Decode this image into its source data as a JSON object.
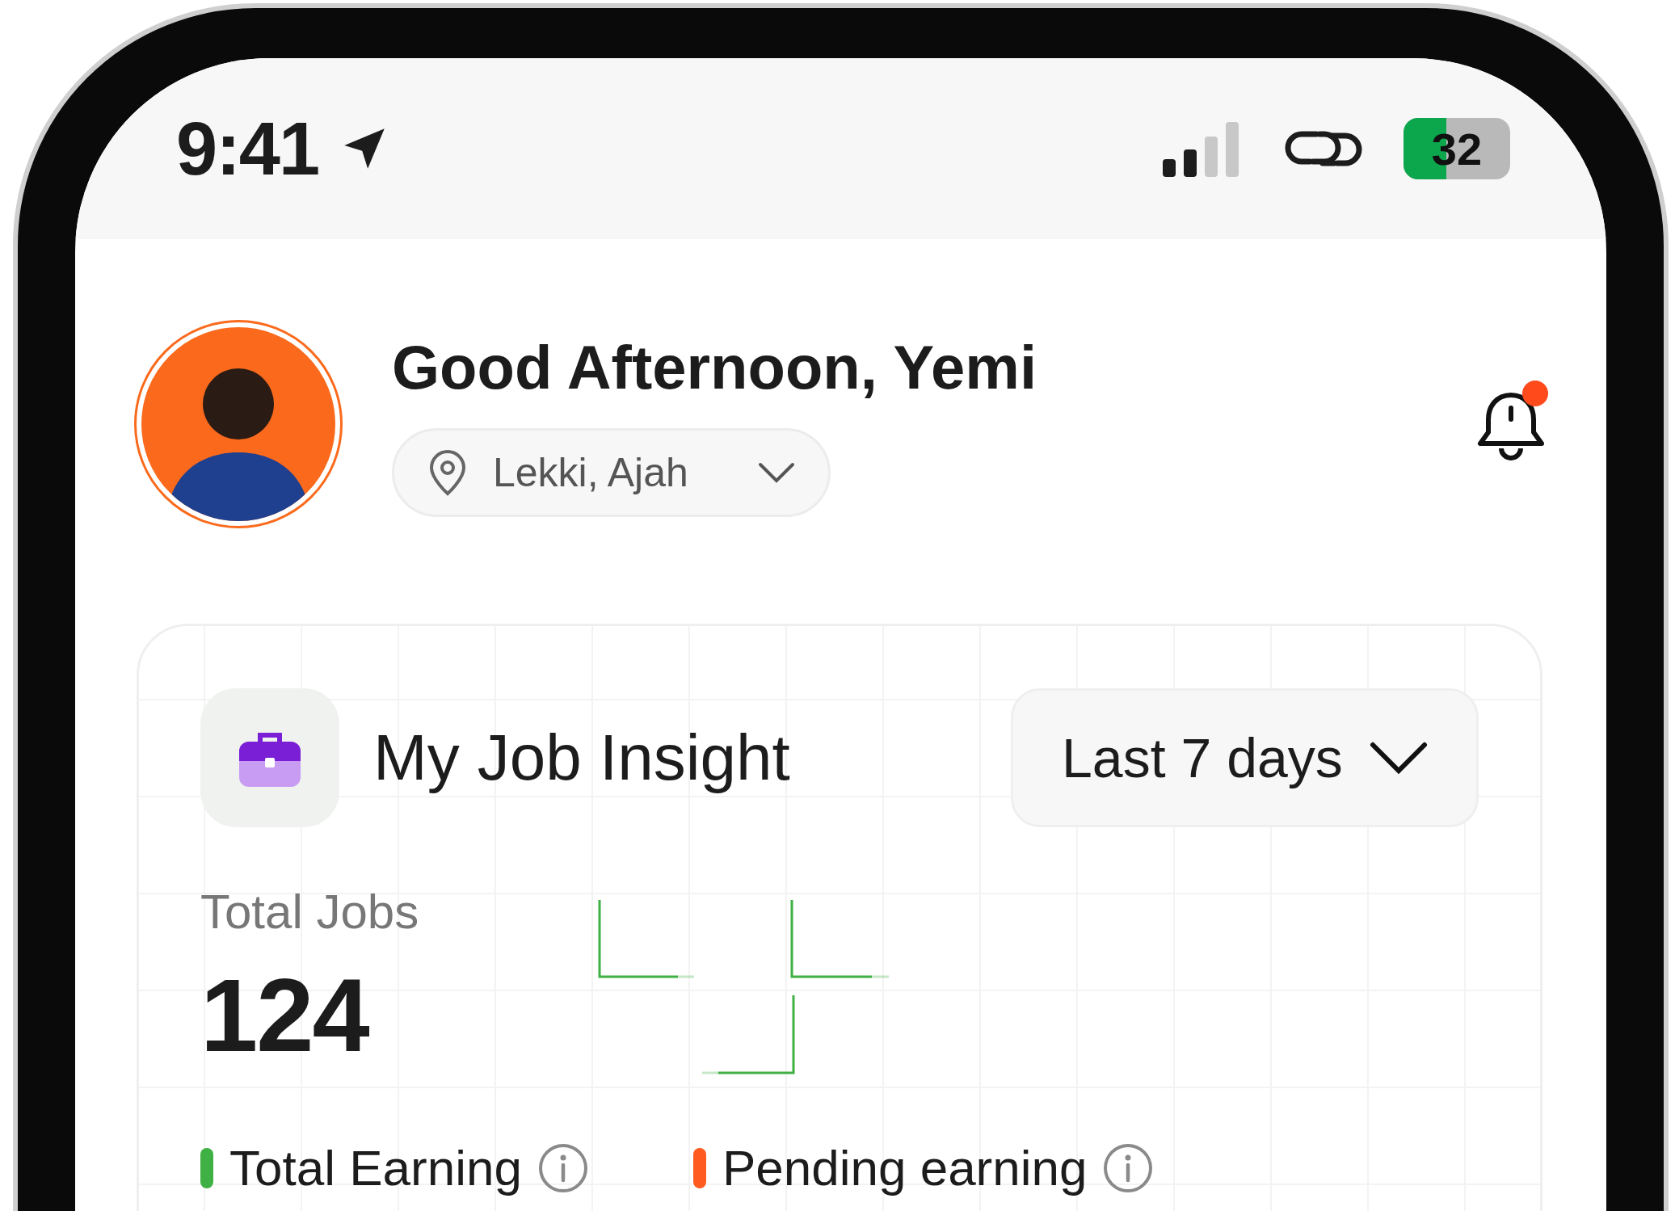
{
  "status_bar": {
    "time": "9:41",
    "battery": "32"
  },
  "header": {
    "greeting": "Good Afternoon, Yemi",
    "location": "Lekki, Ajah",
    "notification_unread": true
  },
  "insight_card": {
    "title": "My Job Insight",
    "period": "Last 7 days",
    "total_label": "Total Jobs",
    "total_value": "124",
    "legend": [
      {
        "label": "Total Earning",
        "color": "#3fb043"
      },
      {
        "label": "Pending earning",
        "color": "#ff5a1f"
      }
    ]
  }
}
